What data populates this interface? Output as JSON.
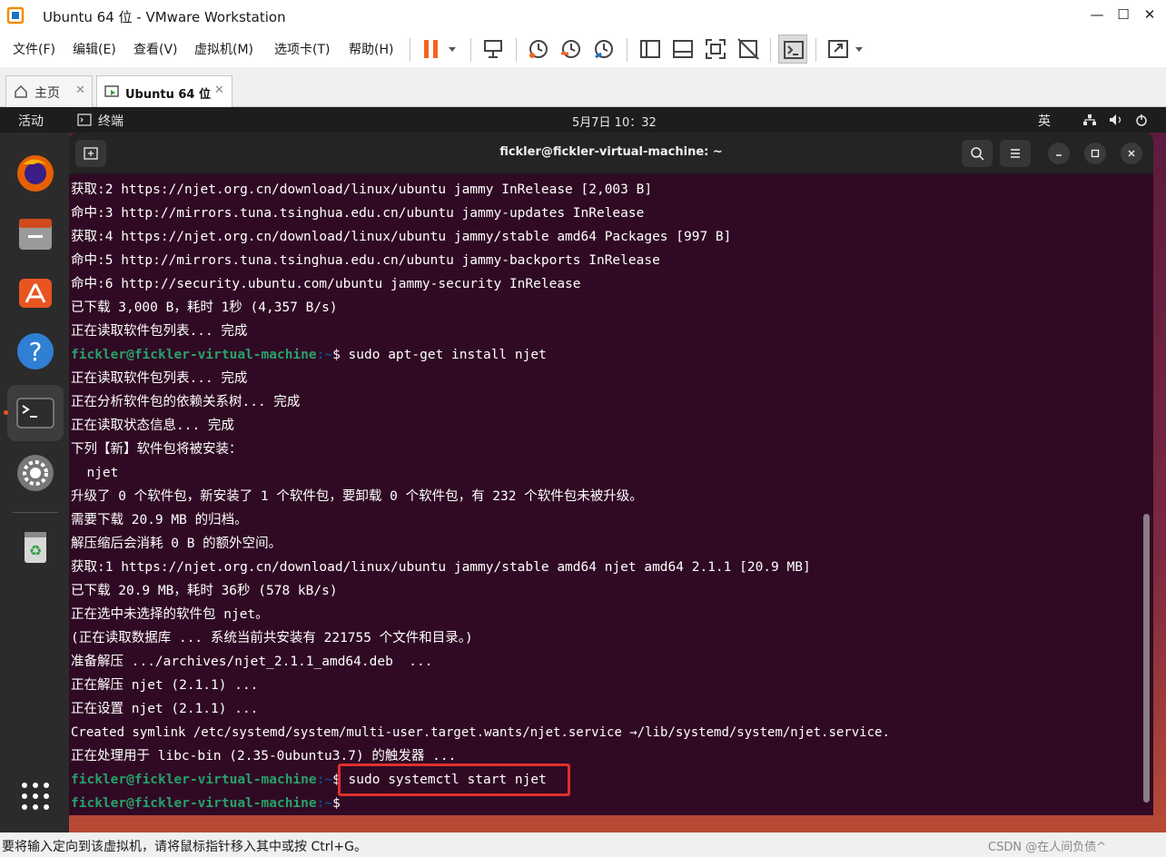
{
  "window": {
    "title": "Ubuntu 64 位 - VMware Workstation"
  },
  "menu": {
    "file": "文件(F)",
    "edit": "编辑(E)",
    "view": "查看(V)",
    "vm": "虚拟机(M)",
    "tabs": "选项卡(T)",
    "help": "帮助(H)"
  },
  "tabs": [
    {
      "label": "主页"
    },
    {
      "label": "Ubuntu 64 位"
    }
  ],
  "ubuntu": {
    "activities": "活动",
    "app_name": "终端",
    "clock": "5月7日  10：32",
    "ime": "英"
  },
  "terminal": {
    "title": "fickler@fickler-virtual-machine: ~",
    "prompt_user": "fickler@fickler-virtual-machine",
    "prompt_path": ":~",
    "lines": [
      "获取:2 https://njet.org.cn/download/linux/ubuntu jammy InRelease [2,003 B]",
      "命中:3 http://mirrors.tuna.tsinghua.edu.cn/ubuntu jammy-updates InRelease",
      "获取:4 https://njet.org.cn/download/linux/ubuntu jammy/stable amd64 Packages [997 B]",
      "命中:5 http://mirrors.tuna.tsinghua.edu.cn/ubuntu jammy-backports InRelease",
      "命中:6 http://security.ubuntu.com/ubuntu jammy-security InRelease",
      "已下载 3,000 B，耗时 1秒 (4,357 B/s)",
      "正在读取软件包列表... 完成",
      "$ sudo apt-get install njet",
      "正在读取软件包列表... 完成",
      "正在分析软件包的依赖关系树... 完成",
      "正在读取状态信息... 完成",
      "下列【新】软件包将被安装：",
      "  njet",
      "升级了 0 个软件包，新安装了 1 个软件包，要卸载 0 个软件包，有 232 个软件包未被升级。",
      "需要下载 20.9 MB 的归档。",
      "解压缩后会消耗 0 B 的额外空间。",
      "获取:1 https://njet.org.cn/download/linux/ubuntu jammy/stable amd64 njet amd64 2.1.1 [20.9 MB]",
      "已下载 20.9 MB，耗时 36秒 (578 kB/s)",
      "正在选中未选择的软件包 njet。",
      "(正在读取数据库 ... 系统当前共安装有 221755 个文件和目录。)",
      "准备解压 .../archives/njet_2.1.1_amd64.deb  ...",
      "正在解压 njet (2.1.1) ...",
      "正在设置 njet (2.1.1) ...",
      "Created symlink /etc/systemd/system/multi-user.target.wants/njet.service →/lib/systemd/system/njet.service.",
      "正在处理用于 libc-bin (2.35-0ubuntu3.7) 的触发器 ...",
      "$ sudo systemctl start njet",
      "$"
    ]
  },
  "status": {
    "message": "要将输入定向到该虚拟机，请将鼠标指针移入其中或按 Ctrl+G。",
    "watermark": "CSDN @在人间负债^"
  },
  "icons": {
    "home": "home-icon",
    "vm_tab": "vm-icon"
  },
  "colors": {
    "terminal_bg": "#300a24",
    "prompt_green": "#26a269",
    "path_blue": "#12488b",
    "highlight_red": "#e0302b",
    "pause_orange": "#f26522"
  }
}
